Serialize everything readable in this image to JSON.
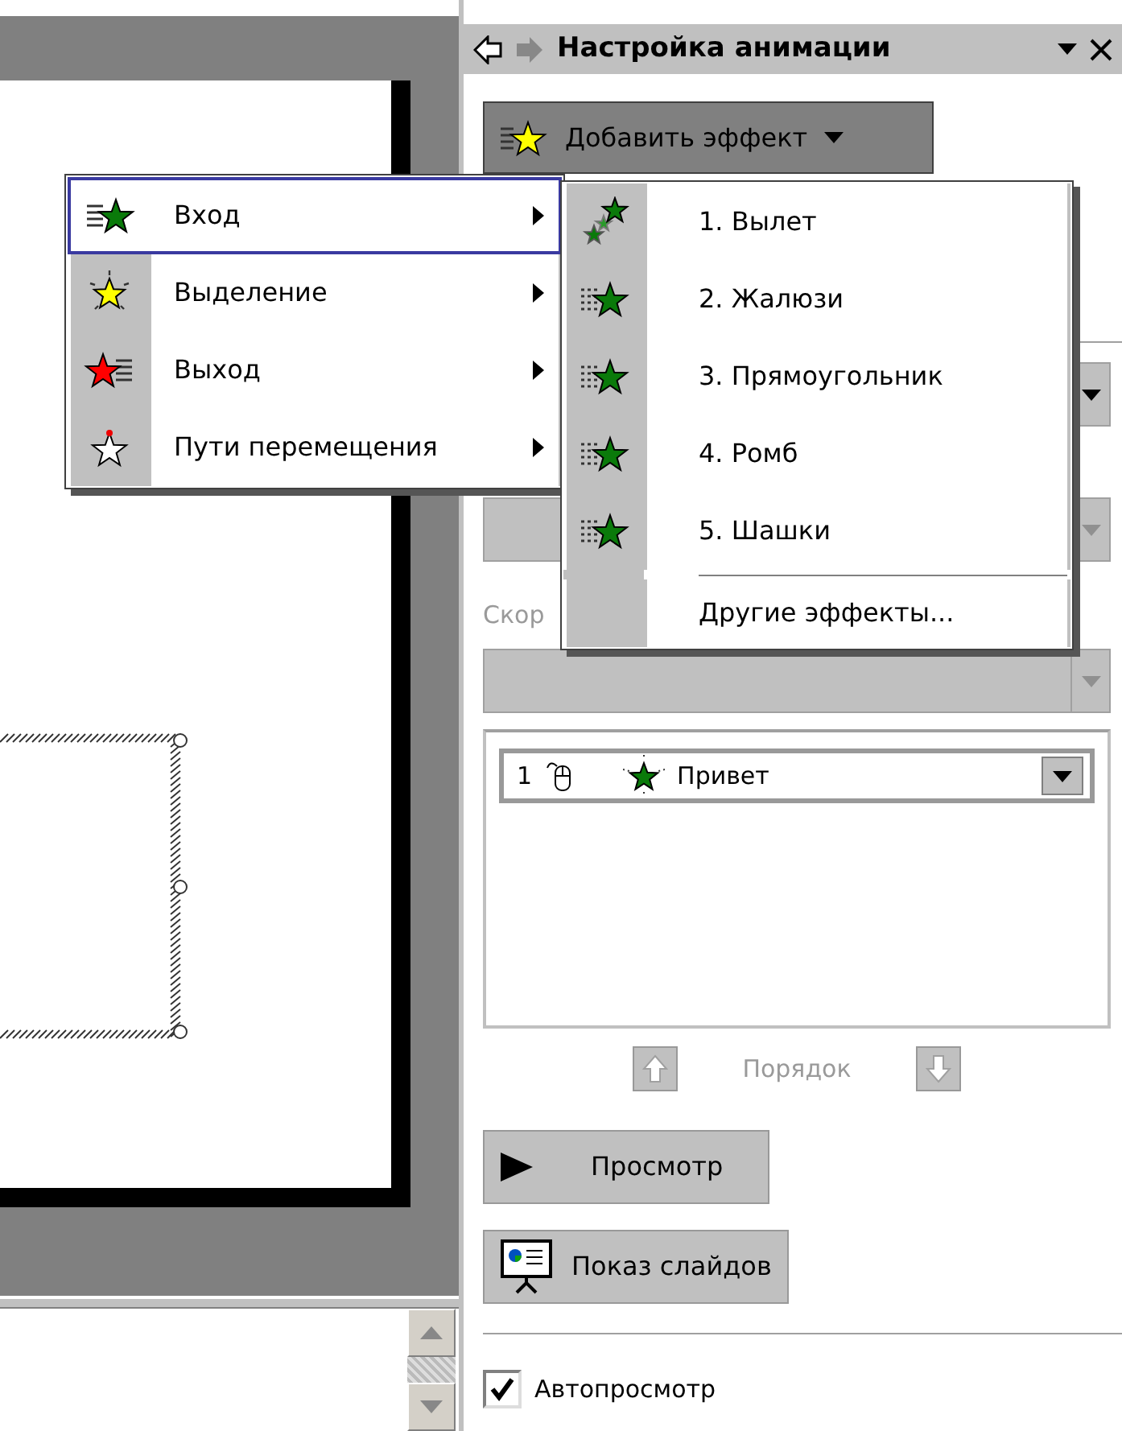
{
  "task_pane": {
    "title": "Настройка анимации",
    "add_effect_button": "Добавить эффект",
    "dropdowns": [
      {
        "disabled": false
      },
      {
        "disabled": true
      },
      {
        "disabled": true
      }
    ],
    "speed_label": "Скор",
    "effect_list": [
      {
        "number": "1",
        "name": "Привет",
        "selected": true
      }
    ],
    "order": {
      "label": "Порядок",
      "disabled": true
    },
    "buttons": [
      {
        "kind": "preview",
        "label": "Просмотр"
      },
      {
        "kind": "slideshow",
        "label": "Показ слайдов"
      }
    ],
    "autopreview": {
      "label": "Автопросмотр",
      "checked": true
    }
  },
  "effect_menu": {
    "items": [
      {
        "kind": "entrance",
        "label": "Вход",
        "selected": true
      },
      {
        "kind": "emphasis",
        "label": "Выделение",
        "selected": false
      },
      {
        "kind": "exit",
        "label": "Выход",
        "selected": false
      },
      {
        "kind": "motion_path",
        "label": "Пути перемещения",
        "selected": false
      }
    ]
  },
  "entrance_submenu": {
    "items": [
      {
        "kind": "fly",
        "label": "1. Вылет"
      },
      {
        "kind": "effect",
        "label": "2. Жалюзи"
      },
      {
        "kind": "effect",
        "label": "3. Прямоугольник"
      },
      {
        "kind": "effect",
        "label": "4. Ромб"
      },
      {
        "kind": "effect",
        "label": "5. Шашки"
      },
      {
        "kind": "more",
        "label": "Другие эффекты..."
      }
    ]
  }
}
